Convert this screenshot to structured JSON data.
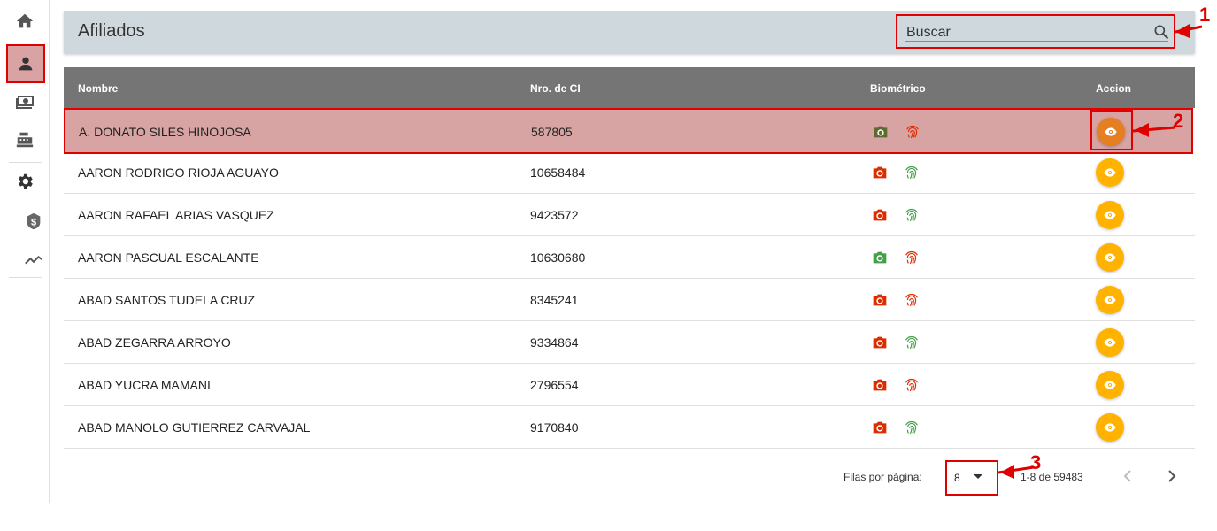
{
  "sidebar": {
    "items": [
      {
        "icon": "home-icon"
      },
      {
        "icon": "person-icon",
        "active": true
      },
      {
        "icon": "money-icon"
      },
      {
        "icon": "cash-register-icon"
      },
      {
        "icon": "gear-icon"
      },
      {
        "icon": "dollar-badge-icon"
      },
      {
        "icon": "trending-icon"
      }
    ]
  },
  "header": {
    "title": "Afiliados",
    "search_placeholder": "Buscar"
  },
  "table": {
    "columns": [
      "Nombre",
      "Nro. de CI",
      "Biométrico",
      "Accion"
    ],
    "rows": [
      {
        "nombre": "A. DONATO SILES HINOJOSA",
        "ci": "587805",
        "photo": "olive",
        "finger": "red"
      },
      {
        "nombre": "AARON RODRIGO RIOJA AGUAYO",
        "ci": "10658484",
        "photo": "red",
        "finger": "green"
      },
      {
        "nombre": "AARON RAFAEL ARIAS VASQUEZ",
        "ci": "9423572",
        "photo": "red",
        "finger": "green"
      },
      {
        "nombre": "AARON PASCUAL ESCALANTE",
        "ci": "10630680",
        "photo": "green",
        "finger": "red"
      },
      {
        "nombre": "ABAD SANTOS TUDELA CRUZ",
        "ci": "8345241",
        "photo": "red",
        "finger": "red"
      },
      {
        "nombre": "ABAD ZEGARRA ARROYO",
        "ci": "9334864",
        "photo": "red",
        "finger": "green"
      },
      {
        "nombre": "ABAD YUCRA MAMANI",
        "ci": "2796554",
        "photo": "red",
        "finger": "red"
      },
      {
        "nombre": "ABAD MANOLO GUTIERREZ CARVAJAL",
        "ci": "9170840",
        "photo": "red",
        "finger": "green"
      }
    ]
  },
  "pagination": {
    "rows_label": "Filas por página:",
    "rows_value": "8",
    "range": "1-8 de 59483"
  },
  "annotations": [
    "1",
    "2",
    "3"
  ],
  "colors": {
    "red_icon": "#dd2c00",
    "green_icon": "#43a047",
    "olive_icon": "#5d6b2f",
    "action": "#ffb300",
    "action_hi": "#e67e22",
    "annotation": "#e00000"
  }
}
